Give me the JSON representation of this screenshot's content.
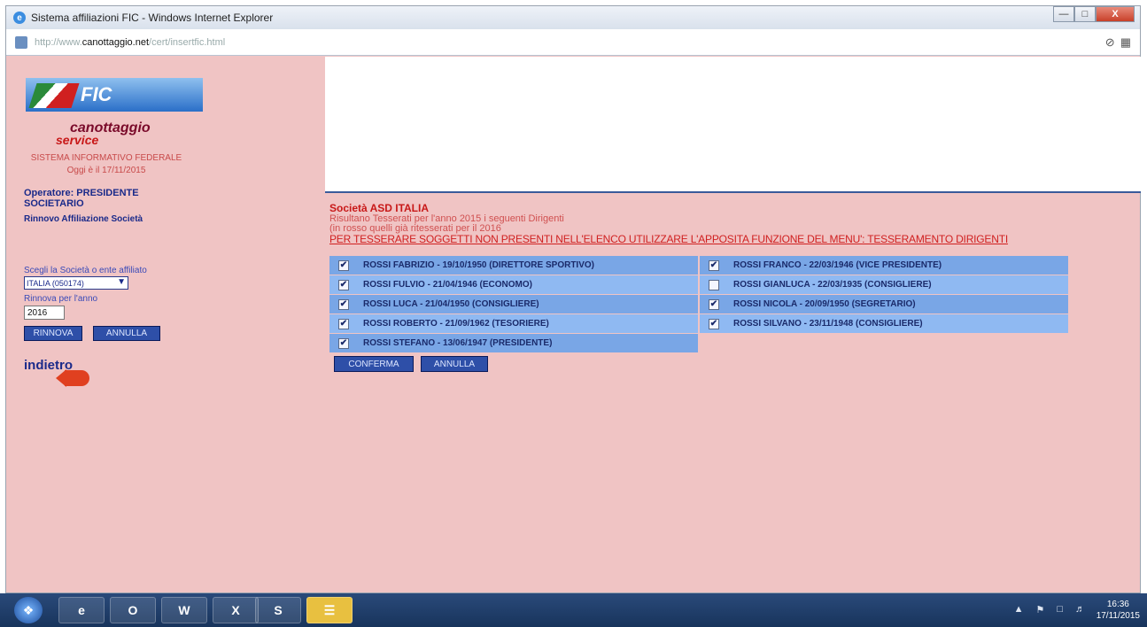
{
  "window": {
    "title": "Sistema affiliazioni FIC - Windows Internet Explorer",
    "url_prefix": "http://www.",
    "url_domain": "canottaggio.net",
    "url_path": "/cert/insertfic.html"
  },
  "sidebar": {
    "logo_text": "FIC",
    "brand_line1": "canottaggio",
    "brand_line2": "service",
    "system_name": "SISTEMA INFORMATIVO FEDERALE",
    "date_line": "Oggi è il 17/11/2015",
    "operator": "Operatore: PRESIDENTE SOCIETARIO",
    "menu_item": "Rinnovo Affiliazione Società",
    "select_label": "Scegli la Società o ente affiliato",
    "select_value": "ITALIA (050174)",
    "year_label": "Rinnova per l'anno",
    "year_value": "2016",
    "renew_btn": "RINNOVA",
    "cancel_btn": "ANNULLA",
    "back_label": "indietro"
  },
  "main": {
    "society_title": "Società ASD ITALIA",
    "info_line1": "Risultano Tesserati per l'anno 2015 i seguenti Dirigenti",
    "info_line2": "(in rosso quelli già ritesserati per il 2016",
    "warning": "PER TESSERARE SOGGETTI NON PRESENTI NELL'ELENCO UTILIZZARE L'APPOSITA FUNZIONE DEL MENU': TESSERAMENTO DIRIGENTI",
    "confirm_btn": "CONFERMA",
    "cancel_btn": "ANNULLA",
    "left_list": [
      {
        "name": "ROSSI FABRIZIO - 19/10/1950 (DIRETTORE SPORTIVO)",
        "checked": true
      },
      {
        "name": "ROSSI FULVIO - 21/04/1946 (ECONOMO)",
        "checked": true
      },
      {
        "name": "ROSSI LUCA - 21/04/1950 (CONSIGLIERE)",
        "checked": true
      },
      {
        "name": "ROSSI ROBERTO - 21/09/1962 (TESORIERE)",
        "checked": true
      },
      {
        "name": "ROSSI STEFANO - 13/06/1947 (PRESIDENTE)",
        "checked": true
      }
    ],
    "right_list": [
      {
        "name": "ROSSI FRANCO - 22/03/1946 (VICE PRESIDENTE)",
        "checked": true
      },
      {
        "name": "ROSSI GIANLUCA - 22/03/1935 (CONSIGLIERE)",
        "checked": false
      },
      {
        "name": "ROSSI NICOLA - 20/09/1950 (SEGRETARIO)",
        "checked": true
      },
      {
        "name": "ROSSI SILVANO - 23/11/1948 (CONSIGLIERE)",
        "checked": true
      }
    ]
  },
  "taskbar": {
    "apps": [
      "IE",
      "Outlook",
      "Word",
      "Excel",
      "Skype",
      "Explorer"
    ],
    "time": "16:36",
    "date": "17/11/2015"
  }
}
